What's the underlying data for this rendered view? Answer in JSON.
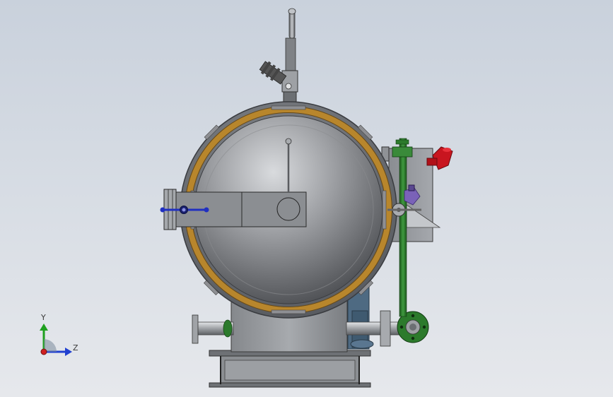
{
  "view": {
    "triad": {
      "y_label": "Y",
      "z_label": "Z"
    },
    "colors": {
      "background_top": "#c9d1dc",
      "background_bottom": "#e6e8ec",
      "shell": "#7a7d82",
      "door_orange": "#b8862c",
      "pipe_green": "#2c7a2c",
      "valve_red": "#c8151f",
      "handle_blue": "#2030c0",
      "steel_light": "#b8bcc2"
    }
  }
}
